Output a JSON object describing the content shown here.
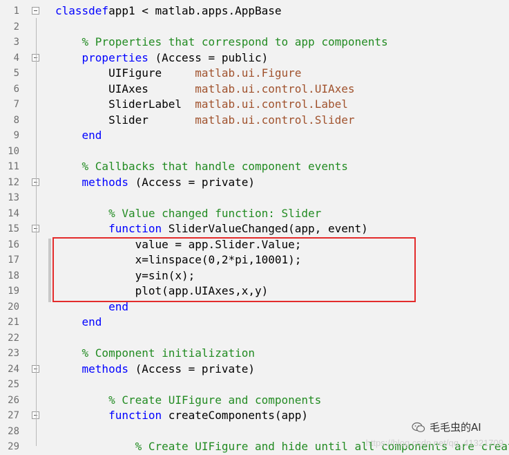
{
  "lines": [
    {
      "n": "1",
      "fold": true,
      "parts": [
        [
          "kw",
          "classdef"
        ],
        [
          "",
          "app1 < matlab.apps.AppBase"
        ]
      ]
    },
    {
      "n": "2",
      "fold": false,
      "parts": []
    },
    {
      "n": "3",
      "fold": false,
      "parts": [
        [
          "",
          "    "
        ],
        [
          "cm",
          "% Properties that correspond to app components"
        ]
      ]
    },
    {
      "n": "4",
      "fold": true,
      "parts": [
        [
          "",
          "    "
        ],
        [
          "kw",
          "properties"
        ],
        [
          "",
          " (Access = public)"
        ]
      ]
    },
    {
      "n": "5",
      "fold": false,
      "parts": [
        [
          "",
          "        UIFigure     "
        ],
        [
          "ty",
          "matlab.ui.Figure"
        ]
      ]
    },
    {
      "n": "6",
      "fold": false,
      "parts": [
        [
          "",
          "        UIAxes       "
        ],
        [
          "ty",
          "matlab.ui.control.UIAxes"
        ]
      ]
    },
    {
      "n": "7",
      "fold": false,
      "parts": [
        [
          "",
          "        SliderLabel  "
        ],
        [
          "ty",
          "matlab.ui.control.Label"
        ]
      ]
    },
    {
      "n": "8",
      "fold": false,
      "parts": [
        [
          "",
          "        Slider       "
        ],
        [
          "ty",
          "matlab.ui.control.Slider"
        ]
      ]
    },
    {
      "n": "9",
      "fold": false,
      "parts": [
        [
          "",
          "    "
        ],
        [
          "kw",
          "end"
        ]
      ]
    },
    {
      "n": "10",
      "fold": false,
      "parts": []
    },
    {
      "n": "11",
      "fold": false,
      "parts": [
        [
          "",
          "    "
        ],
        [
          "cm",
          "% Callbacks that handle component events"
        ]
      ]
    },
    {
      "n": "12",
      "fold": true,
      "parts": [
        [
          "",
          "    "
        ],
        [
          "kw",
          "methods"
        ],
        [
          "",
          " (Access = private)"
        ]
      ]
    },
    {
      "n": "13",
      "fold": false,
      "parts": []
    },
    {
      "n": "14",
      "fold": false,
      "parts": [
        [
          "",
          "        "
        ],
        [
          "cm",
          "% Value changed function: Slider"
        ]
      ]
    },
    {
      "n": "15",
      "fold": true,
      "parts": [
        [
          "",
          "        "
        ],
        [
          "kw",
          "function"
        ],
        [
          "",
          " SliderValueChanged(app, event)"
        ]
      ]
    },
    {
      "n": "16",
      "fold": false,
      "parts": [
        [
          "",
          "            value = app.Slider.Value;"
        ]
      ]
    },
    {
      "n": "17",
      "fold": false,
      "parts": [
        [
          "",
          "            x=linspace(0,2*pi,10001);"
        ]
      ]
    },
    {
      "n": "18",
      "fold": false,
      "parts": [
        [
          "",
          "            y=sin(x);"
        ]
      ]
    },
    {
      "n": "19",
      "fold": false,
      "parts": [
        [
          "",
          "            plot(app.UIAxes,x,y)"
        ]
      ]
    },
    {
      "n": "20",
      "fold": false,
      "parts": [
        [
          "",
          "        "
        ],
        [
          "kw",
          "end"
        ]
      ]
    },
    {
      "n": "21",
      "fold": false,
      "parts": [
        [
          "",
          "    "
        ],
        [
          "kw",
          "end"
        ]
      ]
    },
    {
      "n": "22",
      "fold": false,
      "parts": []
    },
    {
      "n": "23",
      "fold": false,
      "parts": [
        [
          "",
          "    "
        ],
        [
          "cm",
          "% Component initialization"
        ]
      ]
    },
    {
      "n": "24",
      "fold": true,
      "parts": [
        [
          "",
          "    "
        ],
        [
          "kw",
          "methods"
        ],
        [
          "",
          " (Access = private)"
        ]
      ]
    },
    {
      "n": "25",
      "fold": false,
      "parts": []
    },
    {
      "n": "26",
      "fold": false,
      "parts": [
        [
          "",
          "        "
        ],
        [
          "cm",
          "% Create UIFigure and components"
        ]
      ]
    },
    {
      "n": "27",
      "fold": true,
      "parts": [
        [
          "",
          "        "
        ],
        [
          "kw",
          "function"
        ],
        [
          "",
          " createComponents(app)"
        ]
      ]
    },
    {
      "n": "28",
      "fold": false,
      "parts": []
    },
    {
      "n": "29",
      "fold": false,
      "parts": [
        [
          "",
          "            "
        ],
        [
          "cm",
          "% Create UIFigure and hide until all components are creat"
        ]
      ]
    }
  ],
  "watermark": "https://blog.csdn.net/qq_41321709",
  "brand": "毛毛虫的AI",
  "icons": {
    "brand_icon": "wechat-icon"
  },
  "colors": {
    "keyword": "#0000ff",
    "comment": "#228b22",
    "type": "#a0522d",
    "highlight": "#e32b2b"
  }
}
